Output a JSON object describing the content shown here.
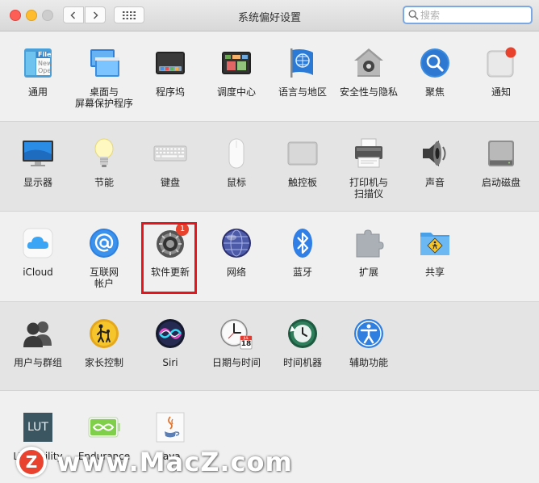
{
  "window": {
    "title": "系统偏好设置",
    "search_placeholder": "搜索"
  },
  "rows": [
    {
      "items": [
        {
          "label": "通用",
          "icon": "general-icon"
        },
        {
          "label": "桌面与\n屏幕保护程序",
          "icon": "desktop-screensaver-icon"
        },
        {
          "label": "程序坞",
          "icon": "dock-icon"
        },
        {
          "label": "调度中心",
          "icon": "mission-control-icon"
        },
        {
          "label": "语言与地区",
          "icon": "language-region-icon"
        },
        {
          "label": "安全性与隐私",
          "icon": "security-privacy-icon"
        },
        {
          "label": "聚焦",
          "icon": "spotlight-icon"
        },
        {
          "label": "通知",
          "icon": "notifications-icon"
        }
      ]
    },
    {
      "items": [
        {
          "label": "显示器",
          "icon": "displays-icon"
        },
        {
          "label": "节能",
          "icon": "energy-saver-icon"
        },
        {
          "label": "键盘",
          "icon": "keyboard-icon"
        },
        {
          "label": "鼠标",
          "icon": "mouse-icon"
        },
        {
          "label": "触控板",
          "icon": "trackpad-icon"
        },
        {
          "label": "打印机与\n扫描仪",
          "icon": "printer-scanner-icon"
        },
        {
          "label": "声音",
          "icon": "sound-icon"
        },
        {
          "label": "启动磁盘",
          "icon": "startup-disk-icon"
        }
      ]
    },
    {
      "items": [
        {
          "label": "iCloud",
          "icon": "icloud-icon"
        },
        {
          "label": "互联网\n帐户",
          "icon": "internet-accounts-icon"
        },
        {
          "label": "软件更新",
          "icon": "software-update-icon",
          "badge": "1"
        },
        {
          "label": "网络",
          "icon": "network-icon"
        },
        {
          "label": "蓝牙",
          "icon": "bluetooth-icon"
        },
        {
          "label": "扩展",
          "icon": "extensions-icon"
        },
        {
          "label": "共享",
          "icon": "sharing-icon"
        }
      ]
    },
    {
      "items": [
        {
          "label": "用户与群组",
          "icon": "users-groups-icon"
        },
        {
          "label": "家长控制",
          "icon": "parental-controls-icon"
        },
        {
          "label": "Siri",
          "icon": "siri-icon"
        },
        {
          "label": "日期与时间",
          "icon": "date-time-icon",
          "calendar_day": "18",
          "calendar_month": "JUL"
        },
        {
          "label": "时间机器",
          "icon": "time-machine-icon"
        },
        {
          "label": "辅助功能",
          "icon": "accessibility-icon"
        }
      ]
    },
    {
      "items": [
        {
          "label": "LUT Utility",
          "icon": "lut-utility-icon",
          "icon_text": "LUT"
        },
        {
          "label": "Endurance",
          "icon": "endurance-icon"
        },
        {
          "label": "Java",
          "icon": "java-icon"
        }
      ]
    }
  ],
  "general_icon_text": [
    "File",
    "New",
    "Ope"
  ],
  "watermark": {
    "badge": "Z",
    "text": "www.MacZ.com"
  },
  "colors": {
    "highlight": "#e8141b",
    "badge": "#e8412c",
    "accent": "#3b7ddd"
  }
}
